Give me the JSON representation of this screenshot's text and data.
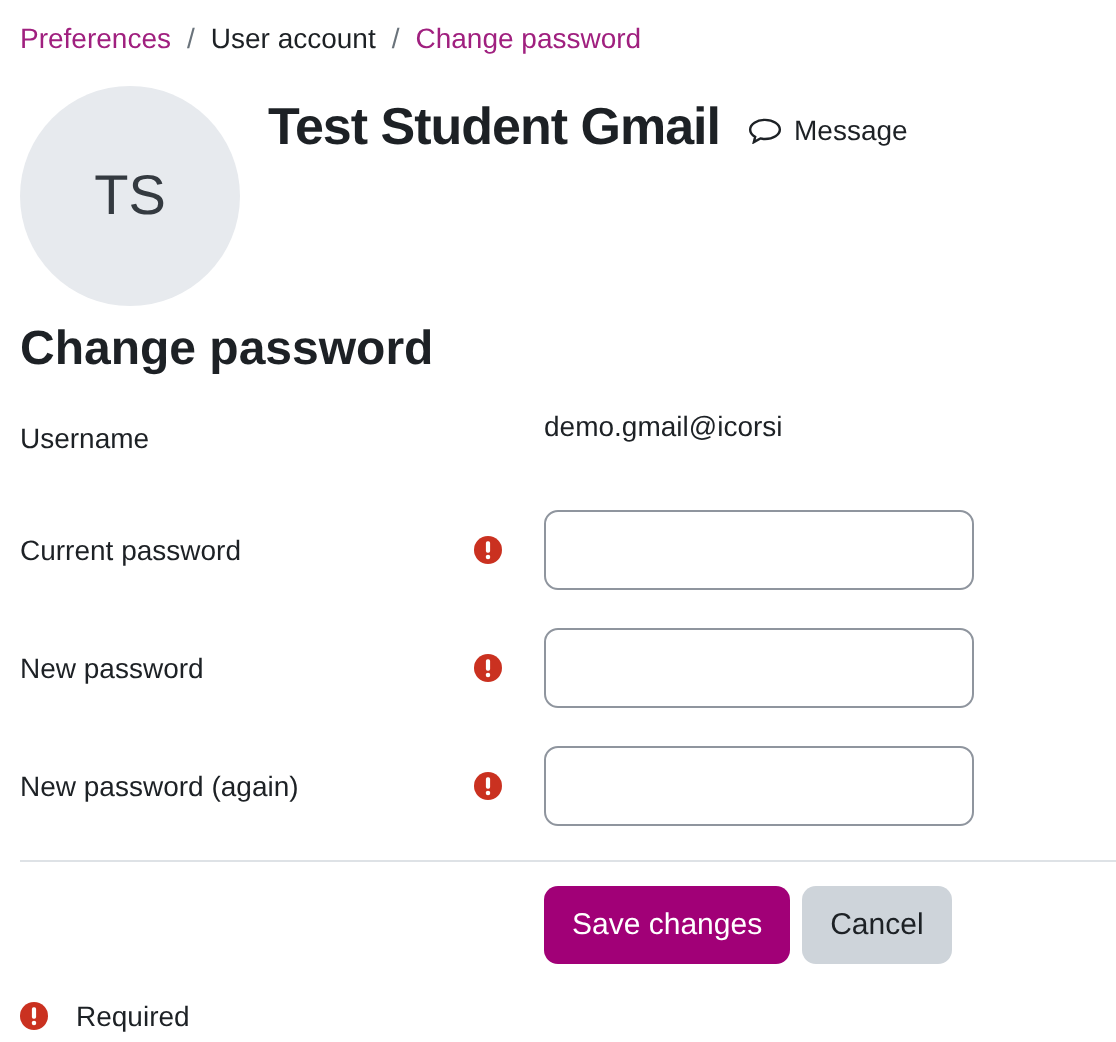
{
  "breadcrumb": [
    {
      "label": "Preferences",
      "kind": "link"
    },
    {
      "label": "/",
      "kind": "separator"
    },
    {
      "label": "User account",
      "kind": "text"
    },
    {
      "label": "/",
      "kind": "separator"
    },
    {
      "label": "Change password",
      "kind": "link"
    }
  ],
  "profile": {
    "initials": "TS",
    "name": "Test Student Gmail",
    "message_label": "Message"
  },
  "heading": "Change password",
  "fields": [
    {
      "label": "Username",
      "kind": "static",
      "required": false,
      "value": "demo.gmail@icorsi"
    },
    {
      "label": "Current password",
      "kind": "password",
      "required": true
    },
    {
      "label": "New password",
      "kind": "password",
      "required": true
    },
    {
      "label": "New password (again)",
      "kind": "password",
      "required": true
    }
  ],
  "buttons": [
    {
      "label": "Save changes",
      "kind": "primary"
    },
    {
      "label": "Cancel",
      "kind": "secondary"
    }
  ],
  "required_note": "Required"
}
